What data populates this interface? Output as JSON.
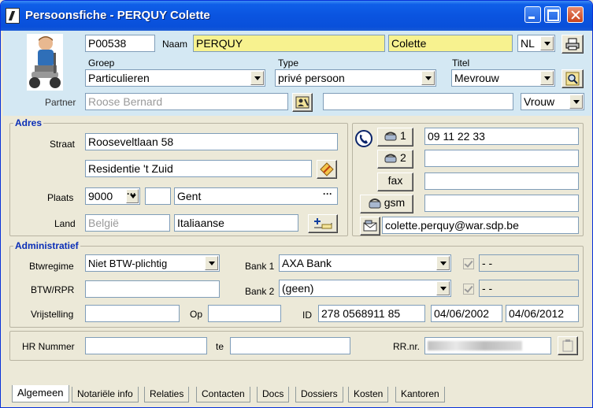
{
  "window": {
    "title": "Persoonsfiche - PERQUY Colette"
  },
  "header": {
    "code": "P00538",
    "naam_label": "Naam",
    "lastname": "PERQUY",
    "firstname": "Colette",
    "language": "NL",
    "groep_label": "Groep",
    "groep_value": "Particulieren",
    "type_label": "Type",
    "type_value": "privé persoon",
    "titel_label": "Titel",
    "titel_value": "Mevrouw",
    "partner_label": "Partner",
    "partner_value": "Roose Bernard",
    "partner_extra": "",
    "partner_relation": "Vrouw"
  },
  "adres": {
    "title": "Adres",
    "straat_label": "Straat",
    "straat_value": "Rooseveltlaan 58",
    "straat2_value": "Residentie 't Zuid",
    "plaats_label": "Plaats",
    "postcode": "9000",
    "plaats_extra": "",
    "gemeente": "Gent",
    "land_label": "Land",
    "land_value": "België",
    "nationaliteit": "Italiaanse"
  },
  "contact": {
    "phone1_label": "1",
    "phone1_value": "09 11 22 33",
    "phone2_label": "2",
    "phone2_value": "",
    "fax_label": "fax",
    "fax_value": "",
    "gsm_label": "gsm",
    "gsm_value": "",
    "email_value": "colette.perquy@war.sdp.be"
  },
  "administratief": {
    "title": "Administratief",
    "btwregime_label": "Btwregime",
    "btwregime_value": "Niet BTW-plichtig",
    "btwrpr_label": "BTW/RPR",
    "btwrpr_value": "",
    "vrijstelling_label": "Vrijstelling",
    "vrijstelling_value": "",
    "op_label": "Op",
    "op_value": "",
    "bank1_label": "Bank 1",
    "bank1_value": "AXA Bank",
    "bank1_account": "-      -",
    "bank2_label": "Bank 2",
    "bank2_value": "(geen)",
    "bank2_account": "-      -",
    "id_label": "ID",
    "id_value": "278 0568911 85",
    "id_from": "04/06/2002",
    "id_to": "04/06/2012",
    "hr_label": "HR Nummer",
    "hr_value": "",
    "te_label": "te",
    "te_value": "",
    "rrnr_label": "RR.nr."
  },
  "tabs": [
    {
      "label": "Algemeen"
    },
    {
      "label": "Notariële info"
    },
    {
      "label": "Relaties"
    },
    {
      "label": "Contacten"
    },
    {
      "label": "Docs"
    },
    {
      "label": "Dossiers"
    },
    {
      "label": "Kosten"
    },
    {
      "label": "Kantoren"
    }
  ],
  "colors": {
    "highlight_yellow": "#F7F28F",
    "section_title_blue": "#0A2EB7",
    "header_band": "#D4E8F3"
  },
  "icons": {
    "avatar": "child-on-scooter-avatar",
    "print": "printer-icon",
    "search": "search-icon",
    "partner_card": "person-card-icon",
    "address_edit": "pencil-edit-icon",
    "add_address": "add-line-icon",
    "phone": "telephone-icon",
    "email": "mail-icon"
  }
}
